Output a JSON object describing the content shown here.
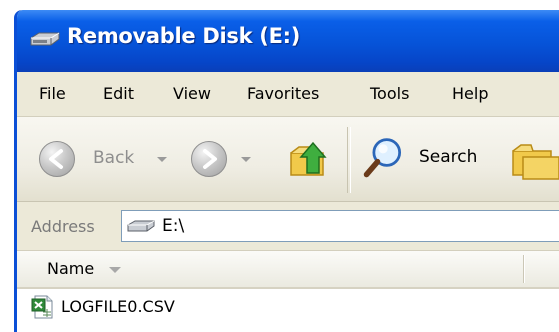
{
  "window": {
    "title": "Removable Disk (E:)"
  },
  "menu": {
    "items": [
      "File",
      "Edit",
      "View",
      "Favorites",
      "Tools",
      "Help"
    ]
  },
  "toolbar": {
    "back_label": "Back",
    "search_label": "Search"
  },
  "address": {
    "label": "Address",
    "value": "E:\\"
  },
  "filelist": {
    "columns": [
      "Name"
    ],
    "items": [
      {
        "name": "LOGFILE0.CSV",
        "icon": "excel-csv-file-icon"
      }
    ]
  },
  "colors": {
    "titlebar_blue": "#0653d8",
    "window_chrome": "#ece9d8",
    "title_text": "#ffffff"
  }
}
